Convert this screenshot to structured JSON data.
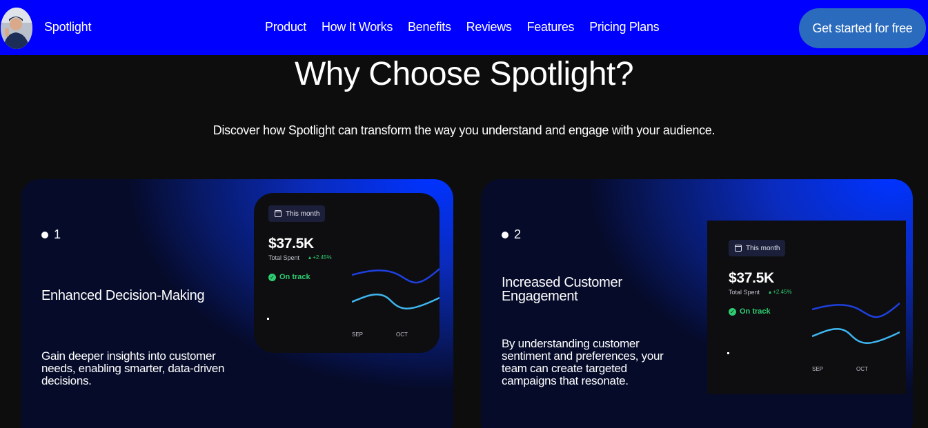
{
  "nav": {
    "brand": "Spotlight",
    "links": [
      "Product",
      "How It Works",
      "Benefits",
      "Reviews",
      "Features",
      "Pricing Plans"
    ],
    "cta": "Get started for free"
  },
  "section": {
    "title": "Why Choose Spotlight?",
    "subtitle": "Discover how Spotlight can transform the way you understand and engage with your audience."
  },
  "cards": [
    {
      "number": "1",
      "title": "Enhanced Decision-Making",
      "description": "Gain deeper insights into customer needs, enabling smarter, data-driven decisions.",
      "widget": {
        "period": "This month",
        "amount": "$37.5K",
        "label": "Total Spent",
        "delta": "+2.45%",
        "status": "On track",
        "x_labels": [
          "SEP",
          "OCT"
        ]
      }
    },
    {
      "number": "2",
      "title": "Increased Customer Engagement",
      "description": "By understanding customer sentiment and preferences, your team can create targeted campaigns that resonate.",
      "widget": {
        "period": "This month",
        "amount": "$37.5K",
        "label": "Total Spent",
        "delta": "+2.45%",
        "status": "On track",
        "x_labels": [
          "SEP",
          "OCT"
        ]
      }
    }
  ],
  "colors": {
    "nav_bg": "#0000ff",
    "cta_bg": "#2a6bbd",
    "page_bg": "#0d0d0d",
    "line_dark": "#1e40e0",
    "line_light": "#3fb6f0",
    "positive": "#2ecc71"
  },
  "icons": [
    "calendar-icon",
    "check-circle-icon",
    "bullet-dot-icon"
  ]
}
